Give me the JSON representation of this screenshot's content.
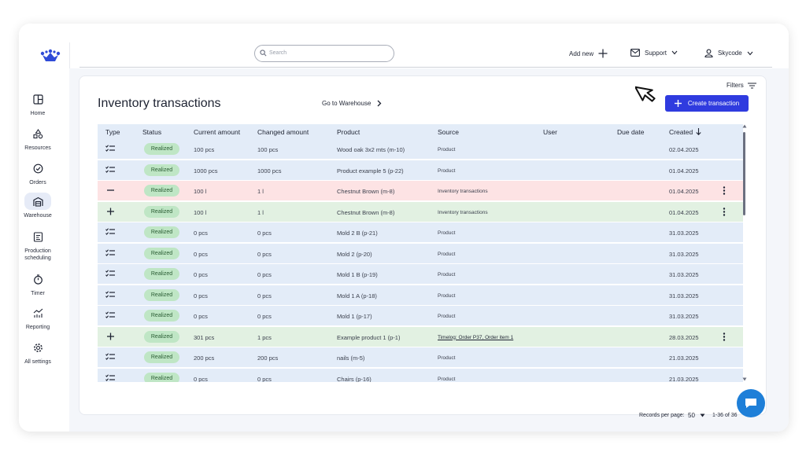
{
  "topbar": {
    "search_placeholder": "Search",
    "add_new": "Add new",
    "support": "Support",
    "user": "Skycode"
  },
  "sidebar": {
    "items": [
      {
        "label": "Home",
        "icon": "home-icon"
      },
      {
        "label": "Resources",
        "icon": "resources-icon"
      },
      {
        "label": "Orders",
        "icon": "orders-icon"
      },
      {
        "label": "Warehouse",
        "icon": "warehouse-icon",
        "active": true
      },
      {
        "label": "Production scheduling",
        "icon": "production-scheduling-icon"
      },
      {
        "label": "Timer",
        "icon": "timer-icon"
      },
      {
        "label": "Reporting",
        "icon": "reporting-icon"
      },
      {
        "label": "All settings",
        "icon": "settings-icon"
      }
    ]
  },
  "page": {
    "title": "Inventory transactions",
    "goto_warehouse": "Go to Warehouse",
    "filters": "Filters",
    "create_button": "Create transaction"
  },
  "table": {
    "columns": [
      "Type",
      "Status",
      "Current amount",
      "Changed amount",
      "Product",
      "Source",
      "User",
      "Due date",
      "Created"
    ],
    "rows": [
      {
        "type": "list",
        "status": "Realized",
        "current": "100 pcs",
        "changed": "100 pcs",
        "product": "Wood oak 3x2 mts (m-10)",
        "source": "Product",
        "created": "02.04.2025",
        "color": "blue",
        "menu": false
      },
      {
        "type": "list",
        "status": "Realized",
        "current": "1000 pcs",
        "changed": "1000 pcs",
        "product": "Product example 5 (p-22)",
        "source": "Product",
        "created": "01.04.2025",
        "color": "blue",
        "menu": false
      },
      {
        "type": "minus",
        "status": "Realized",
        "current": "100 l",
        "changed": "1 l",
        "product": "Chestnut Brown (m-8)",
        "source": "Inventory transactions",
        "created": "01.04.2025",
        "color": "red",
        "menu": true
      },
      {
        "type": "plus",
        "status": "Realized",
        "current": "100 l",
        "changed": "1 l",
        "product": "Chestnut Brown (m-8)",
        "source": "Inventory transactions",
        "created": "01.04.2025",
        "color": "green",
        "menu": true
      },
      {
        "type": "list",
        "status": "Realized",
        "current": "0 pcs",
        "changed": "0 pcs",
        "product": "Mold 2 B (p-21)",
        "source": "Product",
        "created": "31.03.2025",
        "color": "blue",
        "menu": false
      },
      {
        "type": "list",
        "status": "Realized",
        "current": "0 pcs",
        "changed": "0 pcs",
        "product": "Mold 2 (p-20)",
        "source": "Product",
        "created": "31.03.2025",
        "color": "blue",
        "menu": false
      },
      {
        "type": "list",
        "status": "Realized",
        "current": "0 pcs",
        "changed": "0 pcs",
        "product": "Mold 1 B (p-19)",
        "source": "Product",
        "created": "31.03.2025",
        "color": "blue",
        "menu": false
      },
      {
        "type": "list",
        "status": "Realized",
        "current": "0 pcs",
        "changed": "0 pcs",
        "product": "Mold 1 A (p-18)",
        "source": "Product",
        "created": "31.03.2025",
        "color": "blue",
        "menu": false
      },
      {
        "type": "list",
        "status": "Realized",
        "current": "0 pcs",
        "changed": "0 pcs",
        "product": "Mold 1 (p-17)",
        "source": "Product",
        "created": "31.03.2025",
        "color": "blue",
        "menu": false
      },
      {
        "type": "plus",
        "status": "Realized",
        "current": "301 pcs",
        "changed": "1 pcs",
        "product": "Example product 1 (p-1)",
        "source": "Timelog: Order P37, Order item 1",
        "source_link": true,
        "created": "28.03.2025",
        "color": "green",
        "menu": true
      },
      {
        "type": "list",
        "status": "Realized",
        "current": "200 pcs",
        "changed": "200 pcs",
        "product": "nails (m-5)",
        "source": "Product",
        "created": "21.03.2025",
        "color": "blue",
        "menu": false
      },
      {
        "type": "list",
        "status": "Realized",
        "current": "0 pcs",
        "changed": "0 pcs",
        "product": "Chairs (p-16)",
        "source": "Product",
        "created": "21.03.2025",
        "color": "blue",
        "menu": false
      }
    ]
  },
  "footer": {
    "records_label": "Records per page:",
    "records_value": "50",
    "range": "1-36 of 36"
  },
  "colors": {
    "primary": "#2f3bdf",
    "row_blue": "#e3ecf8",
    "row_red": "#fde3e4",
    "row_green": "#e2f1e2",
    "badge": "#bfe6c5",
    "chat": "#1e7fd8"
  }
}
